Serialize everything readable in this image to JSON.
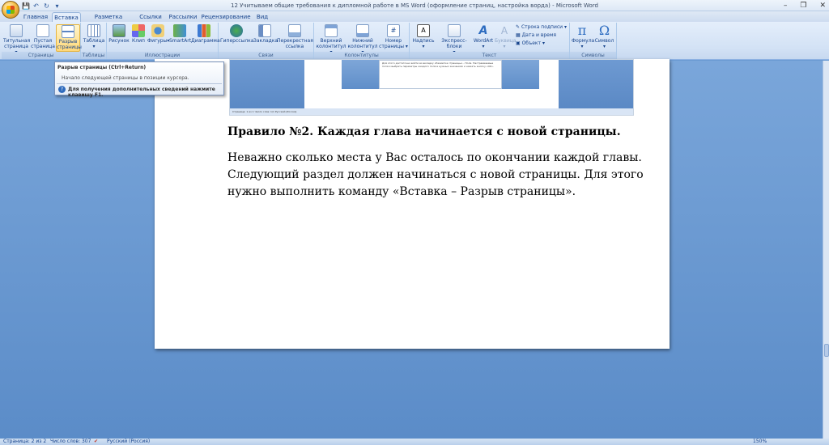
{
  "window": {
    "title": "12 Учитываем общие требования к дипломной работе в MS Word (оформление страниц, настройка ворда) - Microsoft Word",
    "controls": [
      "–",
      "❐",
      "✕"
    ]
  },
  "qat": {
    "items": [
      "💾",
      "↶",
      "↻",
      "▾"
    ]
  },
  "tabs": [
    "Главная",
    "Вставка",
    "Разметка страницы",
    "Ссылки",
    "Рассылки",
    "Рецензирование",
    "Вид"
  ],
  "active_tab": "Вставка",
  "ribbon": {
    "groups": [
      {
        "label": "Страницы",
        "buttons": [
          [
            "Титульная",
            "страница ▾"
          ],
          [
            "Пустая",
            "страница"
          ],
          [
            "Разрыв",
            "страницы"
          ]
        ]
      },
      {
        "label": "Таблицы",
        "buttons": [
          [
            "Таблица",
            "▾"
          ]
        ]
      },
      {
        "label": "Иллюстрации",
        "buttons": [
          [
            "Рисунок",
            ""
          ],
          [
            "Клип",
            ""
          ],
          [
            "Фигуры",
            "▾"
          ],
          [
            "SmartArt",
            ""
          ],
          [
            "Диаграмма",
            ""
          ]
        ]
      },
      {
        "label": "Связи",
        "buttons": [
          [
            "Гиперссылка",
            ""
          ],
          [
            "Закладка",
            ""
          ],
          [
            "Перекрестная",
            "ссылка"
          ]
        ]
      },
      {
        "label": "Колонтитулы",
        "buttons": [
          [
            "Верхний",
            "колонтитул ▾"
          ],
          [
            "Нижний",
            "колонтитул ▾"
          ],
          [
            "Номер",
            "страницы ▾"
          ]
        ]
      },
      {
        "label": "Текст",
        "buttons": [
          [
            "Надпись",
            "▾"
          ],
          [
            "Экспресс-блоки",
            "▾"
          ],
          [
            "WordArt",
            "▾"
          ],
          [
            "Буквица",
            "▾"
          ]
        ],
        "small": [
          "Строка подписи ▾",
          "Дата и время",
          "Объект ▾"
        ]
      },
      {
        "label": "Символы",
        "buttons": [
          [
            "Формула",
            "▾"
          ],
          [
            "Символ",
            "▾"
          ]
        ]
      }
    ]
  },
  "tooltip": {
    "title": "Разрыв страницы (Ctrl+Return)",
    "description": "Начало следующей страницы в позиции курсора.",
    "help": "Для получения дополнительных сведений нажмите клавишу F1."
  },
  "embedded_screenshot": {
    "text": "Для этого достаточно войти во вкладку «Разметка страницы» - Поля. Настраиваемые поля и выбрать параметры каждого поля в нужных значениях и нажать кнопку «ОК».",
    "status": "Страница: 1 из 1    Число слов: 1/1    Русский (Россия)"
  },
  "document": {
    "heading": "Правило №2. Каждая глава начинается с новой страницы.",
    "paragraph": "Неважно сколько места у Вас осталось по окончании каждой главы. Следующий раздел должен начинаться с новой страницы. Для этого нужно выполнить команду «Вставка – Разрыв страницы»."
  },
  "statusbar": {
    "page": "Страница: 2 из 2",
    "words": "Число слов: 307",
    "language": "Русский (Россия)",
    "zoom": "150%"
  },
  "colors": {
    "accent": "#15428b",
    "highlight": "#ffd878",
    "workspace": "#6a9ad2"
  }
}
